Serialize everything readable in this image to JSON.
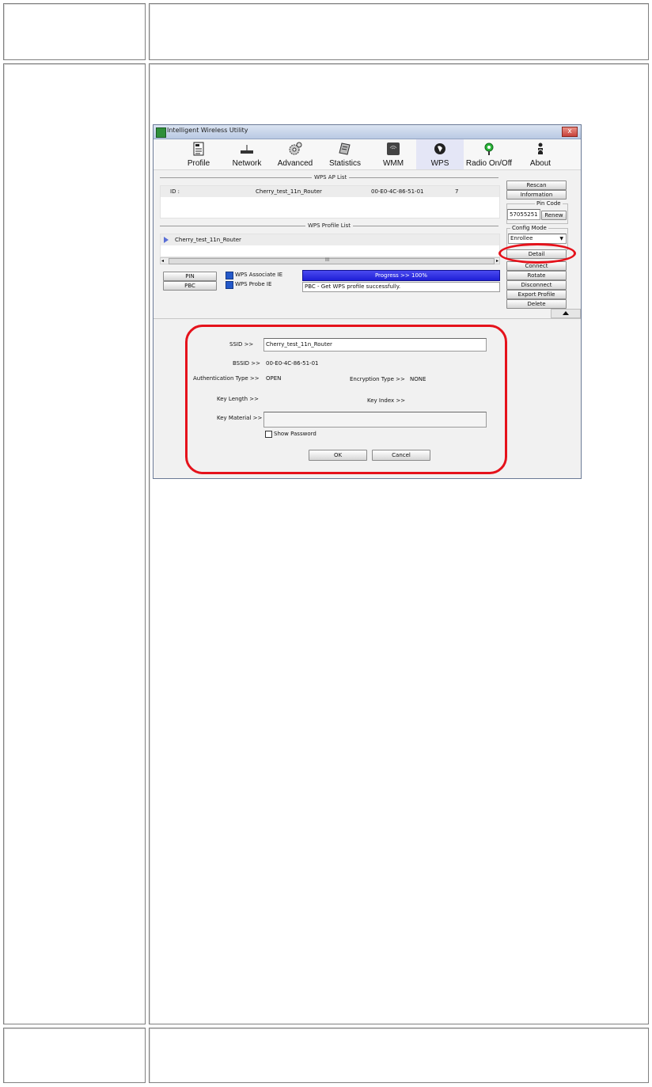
{
  "window": {
    "title": "Intelligent Wireless Utility",
    "close": "x"
  },
  "toolbar": [
    {
      "label": "Profile",
      "icon": "profile-icon"
    },
    {
      "label": "Network",
      "icon": "network-icon"
    },
    {
      "label": "Advanced",
      "icon": "advanced-icon"
    },
    {
      "label": "Statistics",
      "icon": "statistics-icon"
    },
    {
      "label": "WMM",
      "icon": "wmm-icon"
    },
    {
      "label": "WPS",
      "icon": "wps-icon"
    },
    {
      "label": "Radio On/Off",
      "icon": "radio-icon"
    },
    {
      "label": "About",
      "icon": "about-icon"
    }
  ],
  "wps_ap_list": {
    "title": "WPS AP List",
    "row": {
      "id_label": "ID :",
      "ssid": "Cherry_test_11n_Router",
      "bssid": "00-E0-4C-86-51-01",
      "channel": "7"
    }
  },
  "wps_profile_list": {
    "title": "WPS Profile List",
    "item": "Cherry_test_11n_Router",
    "scroll_mark": "III"
  },
  "right_panel": {
    "rescan": "Rescan",
    "information": "Information",
    "pin_code_title": "Pin Code",
    "pin_code": "57055251",
    "renew": "Renew",
    "config_mode_title": "Config Mode",
    "config_mode_value": "Enrollee",
    "detail": "Detail",
    "connect": "Connect",
    "rotate": "Rotate",
    "disconnect": "Disconnect",
    "export_profile": "Export Profile",
    "delete": "Delete"
  },
  "wps_controls": {
    "pin": "PIN",
    "pbc": "PBC",
    "associate_ie": "WPS Associate IE",
    "probe_ie": "WPS Probe IE",
    "progress": "Progress >> 100%",
    "status": "PBC - Get WPS profile successfully."
  },
  "detail": {
    "ssid_label": "SSID >>",
    "ssid_value": "Cherry_test_11n_Router",
    "bssid_label": "BSSID >>",
    "bssid_value": "00-E0-4C-86-51-01",
    "auth_label": "Authentication Type >>",
    "auth_value": "OPEN",
    "enc_label": "Encryption Type >>",
    "enc_value": "NONE",
    "key_length_label": "Key Length >>",
    "key_index_label": "Key Index >>",
    "key_material_label": "Key Material >>",
    "show_password": "Show Password",
    "ok": "OK",
    "cancel": "Cancel"
  },
  "colors": {
    "highlight": "#e5121b",
    "progress": "#1f1fd6"
  }
}
